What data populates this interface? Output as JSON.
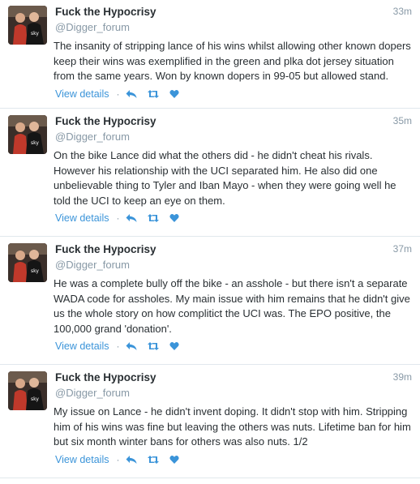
{
  "tweets": [
    {
      "fullname": "Fuck the Hypocrisy",
      "screenname": "@Digger_forum",
      "time": "33m",
      "text": "The insanity of stripping lance of his wins whilst allowing other known dopers keep their wins was exemplified in the green and plka dot jersey situation from the same years. Won by known dopers in 99-05 but allowed stand.",
      "details_label": "View details",
      "separator": "·"
    },
    {
      "fullname": "Fuck the Hypocrisy",
      "screenname": "@Digger_forum",
      "time": "35m",
      "text": "On the bike Lance did what the others did - he didn't cheat his rivals. However his relationship with the UCI separated him. He also did one unbelievable thing to Tyler and Iban Mayo - when they were going well he told the UCI to keep an eye on them.",
      "details_label": "View details",
      "separator": "·"
    },
    {
      "fullname": "Fuck the Hypocrisy",
      "screenname": "@Digger_forum",
      "time": "37m",
      "text": "He was a complete bully off the bike - an asshole - but there isn't a separate WADA code for assholes. My main issue with him remains that he didn't give us the whole story on how complitict the UCI was. The EPO positive, the 100,000 grand 'donation'.",
      "details_label": "View details",
      "separator": "·"
    },
    {
      "fullname": "Fuck the Hypocrisy",
      "screenname": "@Digger_forum",
      "time": "39m",
      "text": "My issue on Lance - he didn't invent doping. It didn't stop with him. Stripping him of his wins was fine but leaving the others was nuts. Lifetime ban for him but six month winter bans for others was also nuts. 1/2",
      "details_label": "View details",
      "separator": "·"
    }
  ],
  "icons": {
    "reply": "reply-icon",
    "retweet": "retweet-icon",
    "favorite": "heart-icon"
  },
  "colors": {
    "link": "#3b94d9",
    "muted": "#8899a6",
    "text": "#292f33",
    "border": "#e1e8ed"
  }
}
